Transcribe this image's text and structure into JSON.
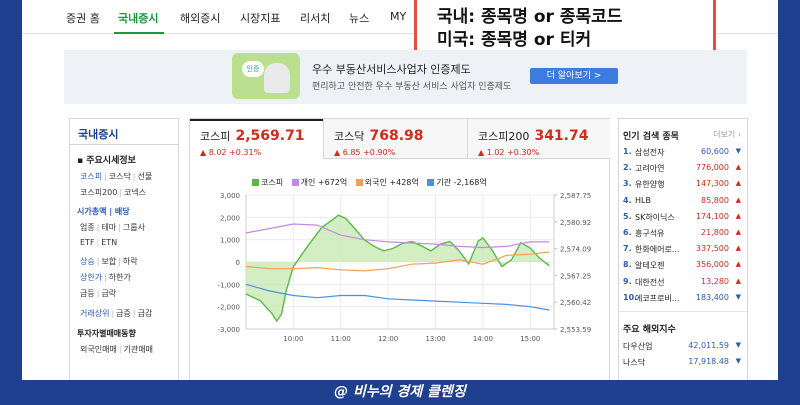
{
  "nav": {
    "items": [
      "증권 홈",
      "국내증시",
      "해외증시",
      "시장지표",
      "리서치",
      "뉴스",
      "MY"
    ],
    "active": "국내증시"
  },
  "callout": {
    "line1": "국내: 종목명 or 종목코드",
    "line2": "미국: 종목명 or 티커"
  },
  "banner": {
    "icon_text": "인증",
    "title": "우수 부동산서비스사업자 인증제도",
    "subtitle": "편리하고 안전한 우수 부동산 서비스 사업자 인증제도",
    "button": "더 알아보기 >"
  },
  "leftnav": {
    "title": "국내증시",
    "section1": "주요시세정보",
    "rows1": [
      [
        "코스피",
        "코스닥",
        "선물"
      ],
      [
        "코스피200",
        "코넥스"
      ]
    ],
    "section2": "시가총액 | 배당",
    "rows2": [
      [
        "업종",
        "테마",
        "그룹사"
      ],
      [
        "ETF",
        "ETN"
      ]
    ],
    "rows3": [
      [
        "상승",
        "보합",
        "하락"
      ],
      [
        "상한가",
        "하한가"
      ],
      [
        "급등",
        "급락"
      ]
    ],
    "rows4": [
      [
        "거래상위",
        "급증",
        "급감"
      ]
    ],
    "section3": "투자자별매매동향",
    "rows5": [
      [
        "외국인매매",
        "기관매매"
      ]
    ]
  },
  "market": {
    "tabs": [
      {
        "name": "코스피",
        "value": "2,569.71",
        "change": "▲ 8.02 +0.31%"
      },
      {
        "name": "코스닥",
        "value": "768.98",
        "change": "▲ 6.85 +0.90%"
      },
      {
        "name": "코스피200",
        "value": "341.74",
        "change": "▲ 1.02 +0.30%"
      }
    ],
    "legend": [
      "코스피",
      "개인 +672억",
      "외국인 +428억",
      "기관 -2,168억"
    ]
  },
  "chart_data": {
    "type": "line",
    "x_ticks": [
      "10:00",
      "11:00",
      "12:00",
      "13:00",
      "14:00",
      "15:00"
    ],
    "y_left_ticks": [
      "3,000",
      "2,000",
      "1,000",
      "0",
      "-1,000",
      "-2,000",
      "-3,000"
    ],
    "y_right_ticks": [
      "2,587.75",
      "2,580.92",
      "2,574.09",
      "2,567.25",
      "2,560.42",
      "2,553.59"
    ],
    "y_left_range": [
      -3000,
      3000
    ],
    "y_right_range": [
      2553.59,
      2587.75
    ],
    "x_range": [
      9,
      15.5
    ],
    "series": [
      {
        "name": "코스피",
        "axis": "right",
        "color": "#5bb848",
        "fill": "#c7eab3",
        "points": [
          [
            9.0,
            2562.5
          ],
          [
            9.3,
            2560.8
          ],
          [
            9.55,
            2557.5
          ],
          [
            9.65,
            2555.6
          ],
          [
            9.75,
            2557.4
          ],
          [
            9.85,
            2563.4
          ],
          [
            10.0,
            2569.5
          ],
          [
            10.2,
            2573.0
          ],
          [
            10.4,
            2576.3
          ],
          [
            10.6,
            2579.5
          ],
          [
            10.8,
            2581.2
          ],
          [
            10.95,
            2582.6
          ],
          [
            11.1,
            2581.8
          ],
          [
            11.3,
            2579.1
          ],
          [
            11.5,
            2576.3
          ],
          [
            11.7,
            2574.7
          ],
          [
            11.9,
            2573.5
          ],
          [
            12.1,
            2574.1
          ],
          [
            12.3,
            2575.4
          ],
          [
            12.5,
            2575.9
          ],
          [
            12.7,
            2574.8
          ],
          [
            12.9,
            2573.5
          ],
          [
            13.1,
            2575.2
          ],
          [
            13.3,
            2575.9
          ],
          [
            13.5,
            2573.5
          ],
          [
            13.7,
            2570.2
          ],
          [
            13.9,
            2576.0
          ],
          [
            14.0,
            2576.8
          ],
          [
            14.2,
            2573.6
          ],
          [
            14.4,
            2569.5
          ],
          [
            14.6,
            2571.2
          ],
          [
            14.8,
            2575.6
          ],
          [
            15.0,
            2574.2
          ],
          [
            15.2,
            2571.6
          ],
          [
            15.4,
            2569.7
          ]
        ]
      },
      {
        "name": "개인 +672억",
        "axis": "left",
        "color": "#c28ae0",
        "points": [
          [
            9.0,
            1300
          ],
          [
            9.5,
            1500
          ],
          [
            10.0,
            1700
          ],
          [
            10.5,
            1650
          ],
          [
            11.0,
            1200
          ],
          [
            11.5,
            1000
          ],
          [
            12.0,
            900
          ],
          [
            12.5,
            850
          ],
          [
            13.0,
            800
          ],
          [
            13.5,
            700
          ],
          [
            14.0,
            650
          ],
          [
            14.5,
            700
          ],
          [
            15.0,
            900
          ],
          [
            15.4,
            900
          ]
        ]
      },
      {
        "name": "외국인 +428억",
        "axis": "left",
        "color": "#f2a058",
        "points": [
          [
            9.0,
            -200
          ],
          [
            9.5,
            -300
          ],
          [
            10.0,
            -300
          ],
          [
            10.5,
            -250
          ],
          [
            11.0,
            -350
          ],
          [
            11.5,
            -400
          ],
          [
            12.0,
            -300
          ],
          [
            12.5,
            -100
          ],
          [
            13.0,
            -50
          ],
          [
            13.5,
            100
          ],
          [
            14.0,
            -100
          ],
          [
            14.5,
            300
          ],
          [
            15.0,
            350
          ],
          [
            15.4,
            450
          ]
        ]
      },
      {
        "name": "기관 -2,168억",
        "axis": "left",
        "color": "#4a90e0",
        "points": [
          [
            9.0,
            -1000
          ],
          [
            9.5,
            -1300
          ],
          [
            10.0,
            -1500
          ],
          [
            10.5,
            -1600
          ],
          [
            11.0,
            -1500
          ],
          [
            11.5,
            -1500
          ],
          [
            12.0,
            -1650
          ],
          [
            12.5,
            -1700
          ],
          [
            13.0,
            -1750
          ],
          [
            13.5,
            -1800
          ],
          [
            14.0,
            -1850
          ],
          [
            14.5,
            -1900
          ],
          [
            15.0,
            -2000
          ],
          [
            15.4,
            -2150
          ]
        ]
      }
    ]
  },
  "ranking": {
    "title": "인기 검색 종목",
    "more": "더보기",
    "items": [
      {
        "no": "1.",
        "name": "삼성전자",
        "price": "60,600",
        "dir": "down"
      },
      {
        "no": "2.",
        "name": "고려아연",
        "price": "776,000",
        "dir": "up"
      },
      {
        "no": "3.",
        "name": "유한양행",
        "price": "147,300",
        "dir": "up"
      },
      {
        "no": "4.",
        "name": "HLB",
        "price": "85,800",
        "dir": "up"
      },
      {
        "no": "5.",
        "name": "SK하이닉스",
        "price": "174,100",
        "dir": "up"
      },
      {
        "no": "6.",
        "name": "흥구석유",
        "price": "21,800",
        "dir": "up"
      },
      {
        "no": "7.",
        "name": "한화에어로...",
        "price": "337,500",
        "dir": "up"
      },
      {
        "no": "8.",
        "name": "알테오젠",
        "price": "356,000",
        "dir": "up"
      },
      {
        "no": "9.",
        "name": "대한전선",
        "price": "13,280",
        "dir": "up"
      },
      {
        "no": "10.",
        "name": "에코프로비...",
        "price": "183,400",
        "dir": "down"
      }
    ],
    "overseas_title": "주요 해외지수",
    "overseas": [
      {
        "name": "다우산업",
        "price": "42,011.59"
      },
      {
        "name": "나스닥",
        "price": "17,918.48"
      }
    ]
  },
  "footer": "@ 비누의 경제 클렌징"
}
